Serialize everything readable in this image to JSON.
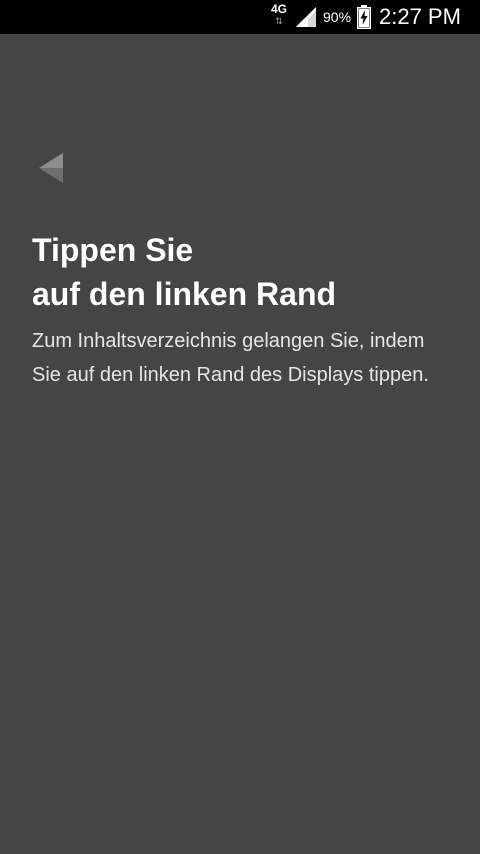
{
  "status_bar": {
    "network": "4G",
    "network_arrows": "⇅",
    "battery": "90%",
    "time": "2:27 PM"
  },
  "icons": {
    "back": "back-arrow-icon",
    "signal": "signal-icon",
    "battery": "battery-charging-icon"
  },
  "content": {
    "title_line1": "Tippen Sie",
    "title_line2": "auf den linken Rand",
    "description": "Zum Inhaltsverzeichnis gelangen Sie, indem Sie auf den linken Rand des Displays tippen."
  },
  "colors": {
    "background": "#454545",
    "status_bar": "#000000",
    "text": "#ffffff"
  }
}
